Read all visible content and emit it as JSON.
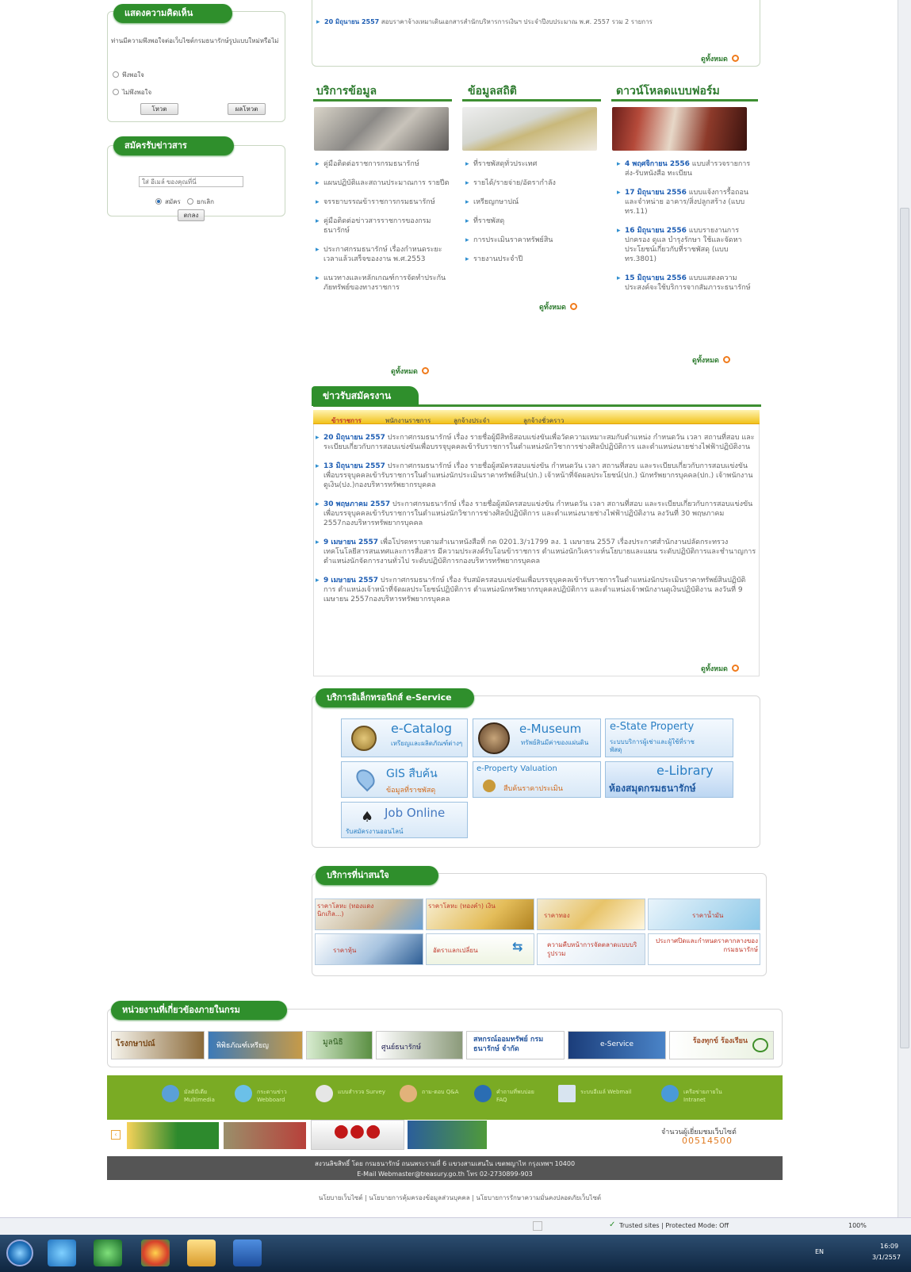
{
  "sidebar": {
    "poll": {
      "title": "แสดงความคิดเห็น",
      "question": "ท่านมีความพึงพอใจต่อเว็บไซต์กรมธนารักษ์รูปแบบใหม่หรือไม่",
      "option1": "พึงพอใจ",
      "option2": "ไม่พึงพอใจ",
      "vote_label": "โหวต",
      "result_label": "ผลโหวต"
    },
    "subscribe": {
      "title": "สมัครรับข่าวสาร",
      "email_placeholder": "ใส่ อีเมล์ ของคุณที่นี่",
      "subscribe_label": "สมัคร",
      "unsubscribe_label": "ยกเลิก",
      "submit_label": "ตกลง"
    }
  },
  "top_announcement": {
    "date": "20 มิถุนายน 2557",
    "text": "สอบราคาจ้างเหมาเดินเอกสารสำนักบริหารการเงินฯ ประจำปีงบประมาณ พ.ศ. 2557 รวม 2 รายการ",
    "more": "ดูทั้งหมด"
  },
  "columns": {
    "services": {
      "title": "บริการข้อมูล",
      "items": [
        "คู่มือติดต่อราชการกรมธนารักษ์",
        "แผนปฏิบัติและสถานประมาณการ รายปีต",
        "จรรยาบรรณข้าราชการกรมธนารักษ์",
        "คู่มือติดต่อข่าวสารราชการของกรมธนารักษ์",
        "ประกาศกรมธนารักษ์ เรื่องกำหนดระยะเวลาแล้วเสร็จของงาน พ.ศ.2553",
        "แนวทางและหลักเกณฑ์การจัดทำประกันภัยทรัพย์ของทางราชการ"
      ],
      "more": "ดูทั้งหมด"
    },
    "statistics": {
      "title": "ข้อมูลสถิติ",
      "items": [
        "ที่ราชพัสดุทั่วประเทศ",
        "รายได้/รายจ่าย/อัตรากำลัง",
        "เหรียญกษาปณ์",
        "ที่ราชพัสดุ",
        "การประเมินราคาทรัพย์สิน",
        "รายงานประจำปี"
      ],
      "more": "ดูทั้งหมด"
    },
    "downloads": {
      "title": "ดาวน์โหลดแบบฟอร์ม",
      "items": [
        {
          "date": "4 พฤศจิกายน 2556",
          "text": "แบบสำรวจรายการส่ง-รับหนังสือ ทะเบียน"
        },
        {
          "date": "17 มิถุนายน 2556",
          "text": "แบบแจ้งการรื้อถอนและจำหน่าย อาคาร/สิ่งปลูกสร้าง (แบบ ทร.11)"
        },
        {
          "date": "16 มิถุนายน 2556",
          "text": "แบบรายงานการปกครอง ดูแล บำรุงรักษา ใช้และจัดหาประโยชน์เกี่ยวกับที่ราชพัสดุ (แบบ ทร.3801)"
        },
        {
          "date": "15 มิถุนายน 2556",
          "text": "แบบแสดงความประสงค์จะใช้บริการจากสัมภาระธนารักษ์"
        }
      ],
      "more": "ดูทั้งหมด"
    }
  },
  "jobs": {
    "title": "ข่าวรับสมัครงาน",
    "tabs": [
      "ข้าราชการ",
      "พนักงานราชการ",
      "ลูกจ้างประจำ",
      "ลูกจ้างชั่วคราว"
    ],
    "items": [
      {
        "date": "20 มิถุนายน 2557",
        "text": "ประกาศกรมธนารักษ์ เรื่อง รายชื่อผู้มีสิทธิสอบแข่งขันเพื่อวัดความเหมาะสมกับตำแหน่ง กำหนดวัน เวลา สถานที่สอบ และระเบียบเกี่ยวกับการสอบแข่งขันเพื่อบรรจุบุคคลเข้ารับราชการในตำแหน่งนักวิชาการช่างศิลป์ปฏิบัติการ และตำแหน่งนายช่างไฟฟ้าปฏิบัติงาน"
      },
      {
        "date": "13 มิถุนายน 2557",
        "text": "ประกาศกรมธนารักษ์ เรื่อง รายชื่อผู้สมัครสอบแข่งขัน กำหนดวัน เวลา สถานที่สอบ และระเบียบเกี่ยวกับการสอบแข่งขันเพื่อบรรจุบุคคลเข้ารับราชการในตำแหน่งนักประเมินราคาทรัพย์สิน(ปก.) เจ้าหน้าที่จัดผลประโยชน์(ปก.) นักทรัพยากรบุคคล(ปก.) เจ้าพนักงานดูเงิน(ปง.)กองบริหารทรัพยากรบุคคล"
      },
      {
        "date": "30 พฤษภาคม 2557",
        "text": "ประกาศกรมธนารักษ์ เรื่อง รายชื่อผู้สมัครสอบแข่งขัน กำหนดวัน เวลา สถานที่สอบ และระเบียบเกี่ยวกับการสอบแข่งขันเพื่อบรรจุบุคคลเข้ารับราชการในตำแหน่งนักวิชาการช่างศิลป์ปฏิบัติการ และตำแหน่งนายช่างไฟฟ้าปฏิบัติงาน ลงวันที่ 30 พฤษภาคม 2557กองบริหารทรัพยากรบุคคล"
      },
      {
        "date": "9 เมษายน 2557",
        "text": "เพื่อโปรดทราบตามสำเนาหนังสือที่ กค 0201.3/ว1799 ลง. 1 เมษายน 2557 เรื่องประกาศสำนักงานปลัดกระทรวงเทคโนโลยีสารสนเทศและการสื่อสาร มีความประสงค์รับโอนข้าราชการ ตำแหน่งนักวิเคราะห์นโยบายและแผน ระดับปฏิบัติการและชำนาญการ ตำแหน่งนักจัดการงานทั่วไป ระดับปฏิบัติการกองบริหารทรัพยากรบุคคล"
      },
      {
        "date": "9 เมษายน 2557",
        "text": "ประกาศกรมธนารักษ์ เรื่อง รับสมัครสอบแข่งขันเพื่อบรรจุบุคคลเข้ารับราชการในตำแหน่งนักประเมินราคาทรัพย์สินปฏิบัติการ ตำแหน่งเจ้าหน้าที่จัดผลประโยชน์ปฏิบัติการ ตำแหน่งนักทรัพยากรบุคคลปฏิบัติการ และตำแหน่งเจ้าพนักงานดูเงินปฏิบัติงาน ลงวันที่ 9 เมษายน 2557กองบริหารทรัพยากรบุคคล"
      }
    ],
    "more": "ดูทั้งหมด"
  },
  "eservice": {
    "title": "บริการอิเล็กทรอนิกส์ e-Service",
    "tiles": [
      {
        "title": "e-Catalog",
        "sub": "เหรียญและผลิตภัณฑ์ต่างๆ"
      },
      {
        "title": "e-Museum",
        "sub": "ทรัพย์สินมีค่าของแผ่นดิน"
      },
      {
        "title": "e-State Property",
        "sub": "ระบบบริการผู้เช่าและผู้ใช้ที่ราชพัสดุ"
      },
      {
        "title": "GIS สืบค้น",
        "sub": "ข้อมูลที่ราชพัสดุ"
      },
      {
        "title": "e-Property Valuation",
        "sub": "สืบค้นราคาประเมิน"
      },
      {
        "title": "e-Library",
        "sub": "ห้องสมุดกรมธนารักษ์"
      },
      {
        "title": "Job Online",
        "sub": "รับสมัครงานออนไลน์"
      }
    ]
  },
  "interesting": {
    "title": "บริการที่น่าสนใจ",
    "items": [
      "ราคาโลหะ (ทองแดงนิกเกิล...)",
      "ราคาโลหะ (ทองคำ) เงิน",
      "ราคาทอง",
      "ราคาน้ำมัน",
      "ราคาหุ้น",
      "อัตราแลกเปลี่ยน",
      "ความคืบหน้าการจัดตลาดแบบบริรูปรวม",
      "ประกาศปิดและกำหนดราคากลางของกรมธนารักษ์"
    ]
  },
  "related": {
    "title": "หน่วยงานที่เกี่ยวข้องภายในกรม",
    "banners": [
      "โรงกษาปณ์",
      "พิพิธภัณฑ์เหรียญ",
      "มูลนิธิ",
      "ศูนย์ธนารักษ์",
      "สหกรณ์ออมทรัพย์ กรมธนารักษ์ จำกัด",
      "e-Service",
      "ร้องทุกข์ ร้องเรียน"
    ]
  },
  "green_bar": [
    "มัลติมีเดีย Multimedia",
    "กระดานข่าว Webboard",
    "แบบสำรวจ Survey",
    "ถาม-ตอบ Q&A",
    "คำถามที่พบบ่อย FAQ",
    "ระบบอีเมล์ Webmail",
    "เครือข่ายภายใน Intranet"
  ],
  "counter": {
    "label": "จำนวนผู้เยี่ยมชมเว็บไซต์",
    "value": "00514500"
  },
  "footer": {
    "line1": "สงวนลิขสิทธิ์ โดย กรมธนารักษ์ ถนนพระรามที่ 6 แขวงสามเสนใน เขตพญาไท กรุงเทพฯ 10400",
    "line2": "E-Mail Webmaster@treasury.go.th โทร 02-2730899-903",
    "links": "นโยบายเว็บไซต์ | นโยบายการคุ้มครองข้อมูลส่วนบุคคล | นโยบายการรักษาความมั่นคงปลอดภัยเว็บไซต์"
  },
  "statusbar": {
    "zone": "Trusted sites | Protected Mode: Off",
    "zoom": "100%"
  },
  "taskbar": {
    "lang": "EN",
    "time": "16:09",
    "date": "3/1/2557"
  },
  "colors": {
    "green": "#2f8f2c",
    "link_blue": "#1d5db3",
    "orange": "#f07b1c"
  }
}
